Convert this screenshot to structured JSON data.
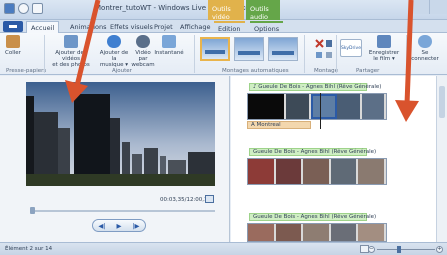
{
  "window": {
    "title": "Montrer_tutoWT - Windows Live Movie Maker",
    "contextual_video": "Outils vidéo",
    "contextual_audio": "Outils audio"
  },
  "tabs": [
    {
      "label": "Accueil",
      "active": true
    },
    {
      "label": "Animations",
      "active": false
    },
    {
      "label": "Effets visuels",
      "active": false
    },
    {
      "label": "Projet",
      "active": false
    },
    {
      "label": "Affichage",
      "active": false
    },
    {
      "label": "Edition",
      "active": false
    },
    {
      "label": "Options",
      "active": false
    }
  ],
  "ribbon": {
    "coller": "Coller",
    "ajouter_videos": "Ajouter des vidéos\net des photos",
    "ajouter_musique": "Ajouter de la\nmusique ▾",
    "webcam": "Vidéo par\nwebcam",
    "instantane": "Instantané",
    "skydrive": "SkyDrive",
    "enregistrer": "Enregistrer\nle film ▾",
    "se_connecter": "Se\nconnecter",
    "groups": {
      "presse_papiers": "Presse-papiers",
      "ajouter": "Ajouter",
      "montages": "Montages automatiques",
      "montage": "Montage",
      "partager": "Partager"
    }
  },
  "player": {
    "time": "00:03,35/12:00,11"
  },
  "storyboard": {
    "clips": [
      {
        "caption": "♪ Gueule De Bois - Agnes Bihl (Rêve Générale)",
        "text_label": "A Montreal"
      },
      {
        "caption": "Gueule De Bois - Agnes Bihl (Rêve Générale)"
      },
      {
        "caption": "Gueule De Bois - Agnes Bihl (Rêve Générale)"
      }
    ]
  },
  "status": {
    "text": "Élément 2 sur 14",
    "zoom_level": 0.35
  },
  "colors": {
    "annotation_arrow": "#d9532d",
    "video_tools": "#e1b24b",
    "audio_tools": "#65a649"
  }
}
